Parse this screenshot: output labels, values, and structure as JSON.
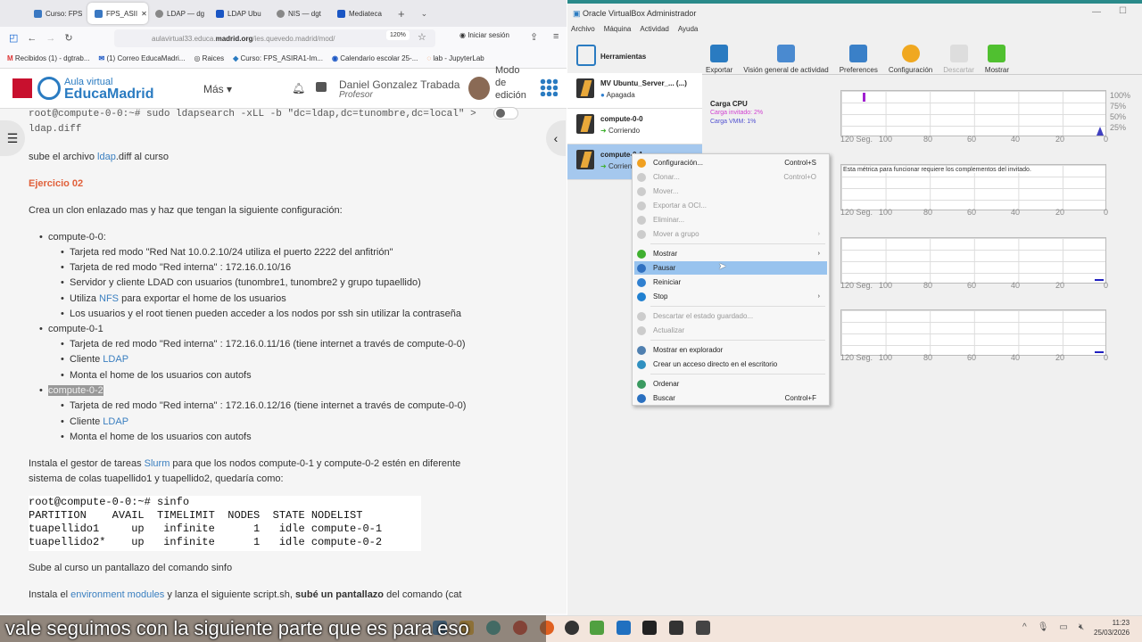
{
  "browser": {
    "tabs": [
      {
        "label": "Curso: FPS"
      },
      {
        "label": "FPS_ASII",
        "active": true
      },
      {
        "label": "LDAP — dg"
      },
      {
        "label": "LDAP Ubu"
      },
      {
        "label": "NIS — dgt"
      },
      {
        "label": "Mediateca"
      }
    ],
    "url_host": "aulavirtual33.educa.",
    "url_domain": "madrid.org",
    "url_path": "/ies.quevedo.madrid/mod/",
    "zoom": "120%",
    "login": "Iniciar sesión",
    "bookmarks": [
      "Recibidos (1) - dgtrab...",
      "(1) Correo EducaMadri...",
      "Raices",
      "Curso: FPS_ASIRA1-Im...",
      "Calendario escolar 25-...",
      "lab - JupyterLab"
    ]
  },
  "site": {
    "logo_top": "Aula virtual",
    "logo_main": "EducaMadrid",
    "more": "Más ▾",
    "user_name": "Daniel Gonzalez Trabada",
    "user_role": "Profesor",
    "edit_mode": "Modo de edición"
  },
  "content": {
    "cmd_line1": "root@compute-0-0:~# sudo ldapsearch -xLL -b \"dc=ldap,dc=tunombre,dc=local\" >",
    "cmd_line2": "ldap.diff",
    "upload_pre": "sube el archivo ",
    "upload_link": "ldap",
    "upload_post": ".diff al curso",
    "exercise": "Ejercicio 02",
    "intro": "Crea un clon enlazado mas y haz que tengan la siguiente configuración:",
    "n0": "compute-0-0:",
    "n0_1": "Tarjeta red modo \"Red Nat 10.0.2.10/24 utiliza el puerto 2222 del anfitrión\"",
    "n0_2": "Tarjeta de red modo \"Red interna\" : 172.16.0.10/16",
    "n0_3": "Servidor y cliente LDAD con usuarios (tunombre1, tunombre2 y grupo tupaellido)",
    "n0_4a": "Utiliza ",
    "n0_4l": "NFS",
    "n0_4b": " para exportar el home de los usuarios",
    "n0_5": "Los usuarios y el root tienen pueden acceder a los nodos por ssh sin utilizar la contraseña",
    "n1": "compute-0-1",
    "n1_1": "Tarjeta de red modo \"Red interna\" : 172.16.0.11/16 (tiene internet a través de compute-0-0)",
    "client": "Cliente ",
    "ldap": "LDAP",
    "autofs": "Monta el home de los usuarios con autofs",
    "n2": "compute-0-2",
    "n2_1": "Tarjeta de red modo \"Red interna\" : 172.16.0.12/16 (tiene internet a través de compute-0-0)",
    "slurm_a": "Instala el gestor de tareas ",
    "slurm_l": "Slurm",
    "slurm_b": " para que los nodos compute-0-1 y compute-0-2 estén en diferente",
    "slurm_c": "sistema de colas tuapellido1 y tuapellido2, quedaría como:",
    "sinfo": "root@compute-0-0:~# sinfo\nPARTITION    AVAIL  TIMELIMIT  NODES  STATE NODELIST\ntuapellido1     up   infinite      1   idle compute-0-1\ntuapellido2*    up   infinite      1   idle compute-0-2",
    "sinfo_upload": "Sube al curso un pantallazo del comando sinfo",
    "env_a": "Instala el ",
    "env_l": "environment modules",
    "env_b": " y lanza el siguiente script.sh, ",
    "env_bold": "subé un pantallazo",
    "env_c": " del comando (cat"
  },
  "vbox": {
    "title": "Oracle VirtualBox Administrador",
    "menu": [
      "Archivo",
      "Máquina",
      "Actividad",
      "Ayuda"
    ],
    "tools": "Herramientas",
    "vms": [
      {
        "name": "MV Ubuntu_Server_... (...)",
        "state": "Apagada"
      },
      {
        "name": "compute-0-0",
        "state": "Corriendo"
      },
      {
        "name": "compute-0-1",
        "state": "Corriendo"
      }
    ],
    "toolbar": [
      "Exportar",
      "Visión general de actividad",
      "Preferences",
      "Configuración",
      "Descartar",
      "Mostrar"
    ],
    "cpu_label": "Carga CPU",
    "cpu_guest": "Carga invitado: 2%",
    "cpu_vmm": "Carga VMM: 1%",
    "guest_msg": "Esta métrica para funcionar requiere los complementos del invitado.",
    "x_ticks": [
      "120 Seg.",
      "100",
      "80",
      "60",
      "40",
      "20",
      "0"
    ],
    "y_ticks": [
      "100%",
      "75%",
      "50%",
      "25%"
    ],
    "cpu_guest_percent": 2,
    "cpu_vmm_percent": 1
  },
  "context_menu": [
    {
      "label": "Configuración...",
      "shortcut": "Control+S",
      "color": "#f0a020"
    },
    {
      "label": "Clonar...",
      "shortcut": "Control+O",
      "disabled": true
    },
    {
      "label": "Mover...",
      "disabled": true
    },
    {
      "label": "Exportar a OCI...",
      "disabled": true
    },
    {
      "label": "Eliminar...",
      "disabled": true
    },
    {
      "label": "Mover a grupo",
      "disabled": true,
      "submenu": "›"
    },
    {
      "label": "Mostrar",
      "submenu": "›",
      "color": "#40b030"
    },
    {
      "label": "Pausar",
      "highlighted": true,
      "color": "#3070c0"
    },
    {
      "label": "Reiniciar",
      "color": "#3080d0"
    },
    {
      "label": "Stop",
      "submenu": "›",
      "color": "#2080d0"
    },
    {
      "label": "Descartar el estado guardado...",
      "disabled": true
    },
    {
      "label": "Actualizar",
      "disabled": true
    },
    {
      "label": "Mostrar en explorador",
      "color": "#5080b0"
    },
    {
      "label": "Crear un acceso directo en el escritorio",
      "color": "#3090c0"
    },
    {
      "label": "Ordenar",
      "color": "#3a9a60"
    },
    {
      "label": "Buscar",
      "shortcut": "Control+F",
      "color": "#2a70c0"
    }
  ],
  "taskbar": {
    "caption": "vale seguimos con la siguiente parte que es para eso",
    "time": "11:23",
    "date": "25/03/2026"
  }
}
